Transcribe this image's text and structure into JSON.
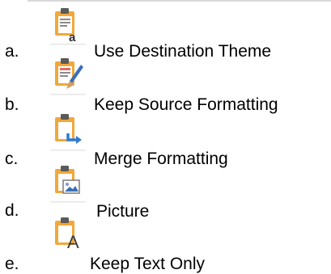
{
  "options": [
    {
      "letter": "a.",
      "label": "Use Destination Theme",
      "icon": "paste-use-destination-theme-icon"
    },
    {
      "letter": "b.",
      "label": "Keep Source Formatting",
      "icon": "paste-keep-source-formatting-icon"
    },
    {
      "letter": "c.",
      "label": "Merge Formatting",
      "icon": "paste-merge-formatting-icon"
    },
    {
      "letter": "d.",
      "label": "Picture",
      "icon": "paste-picture-icon"
    },
    {
      "letter": "e.",
      "label": "Keep Text Only",
      "icon": "paste-keep-text-only-icon"
    }
  ],
  "colors": {
    "clipboard_orange": "#f0a83a",
    "clipboard_dark": "#5a5a5a",
    "arrow_blue": "#2e7bd6",
    "text": "#000000"
  }
}
